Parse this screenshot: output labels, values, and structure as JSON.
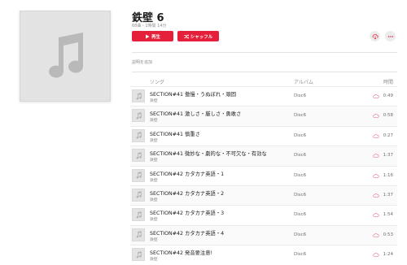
{
  "album": {
    "title": "鉄壁 6",
    "meta": "68曲・1時間 14分",
    "artwork_icon": "music-note-icon"
  },
  "actions": {
    "play_label": "再生",
    "shuffle_label": "シャッフル",
    "download_icon": "cloud-download-icon",
    "more_icon": "more-icon"
  },
  "description_placeholder": "説明を追加",
  "columns": {
    "song": "ソング",
    "album": "アルバム",
    "time": "時間"
  },
  "colors": {
    "accent": "#e5203a"
  },
  "tracks": [
    {
      "title": "SECTION#41 傲慢・うぬぼれ・頑固",
      "artist": "鉄壁",
      "album": "Disc6",
      "time": "0:49"
    },
    {
      "title": "SECTION#41 激しさ・厳しさ・勇敢さ",
      "artist": "鉄壁",
      "album": "Disc6",
      "time": "0:58"
    },
    {
      "title": "SECTION#41 慎重さ",
      "artist": "鉄壁",
      "album": "Disc6",
      "time": "0:27"
    },
    {
      "title": "SECTION#41 微妙な・劇的な・不可欠な・有効な",
      "artist": "鉄壁",
      "album": "Disc6",
      "time": "1:37"
    },
    {
      "title": "SECTION#42 カタカナ英語・1",
      "artist": "鉄壁",
      "album": "Disc6",
      "time": "1:16"
    },
    {
      "title": "SECTION#42 カタカナ英語・2",
      "artist": "鉄壁",
      "album": "Disc6",
      "time": "1:37"
    },
    {
      "title": "SECTION#42 カタカナ英語・3",
      "artist": "鉄壁",
      "album": "Disc6",
      "time": "1:54"
    },
    {
      "title": "SECTION#42 カタカナ英語・4",
      "artist": "鉄壁",
      "album": "Disc6",
      "time": "0:53"
    },
    {
      "title": "SECTION#42 発音要注意!",
      "artist": "鉄壁",
      "album": "Disc6",
      "time": "1:24"
    }
  ]
}
